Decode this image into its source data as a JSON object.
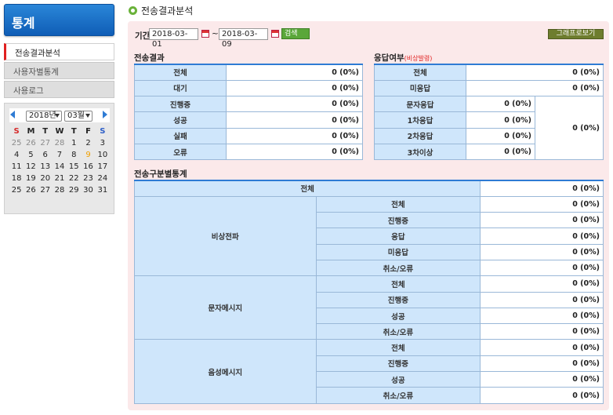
{
  "sidebar": {
    "title": "통계",
    "menu": [
      {
        "label": "전송결과분석",
        "active": true
      },
      {
        "label": "사용자별통계",
        "active": false
      },
      {
        "label": "사용로그",
        "active": false
      }
    ],
    "calendar": {
      "year_label": "2018년",
      "month_label": "03월",
      "weekdays": [
        "S",
        "M",
        "T",
        "W",
        "T",
        "F",
        "S"
      ],
      "weeks": [
        [
          "25",
          "26",
          "27",
          "28",
          "1",
          "2",
          "3"
        ],
        [
          "4",
          "5",
          "6",
          "7",
          "8",
          "9",
          "10"
        ],
        [
          "11",
          "12",
          "13",
          "14",
          "15",
          "16",
          "17"
        ],
        [
          "18",
          "19",
          "20",
          "21",
          "22",
          "23",
          "24"
        ],
        [
          "25",
          "26",
          "27",
          "28",
          "29",
          "30",
          "31"
        ]
      ],
      "colors": {
        "sunday": "#d62a2a",
        "saturday": "#2e5fc8",
        "other_month": "#8a8a8a",
        "today": "#f0a000",
        "normal": "#222222"
      }
    }
  },
  "page": {
    "title": "전송결과분석"
  },
  "filter": {
    "label": "기간",
    "start": "2018-03-01",
    "sep": "~",
    "end": "2018-03-09",
    "search_label": "검색",
    "graph_label": "그래프로보기"
  },
  "result": {
    "title": "전송결과",
    "rows": [
      {
        "label": "전체",
        "value": "0 (0%)"
      },
      {
        "label": "대기",
        "value": "0 (0%)"
      },
      {
        "label": "진행중",
        "value": "0 (0%)"
      },
      {
        "label": "성공",
        "value": "0 (0%)"
      },
      {
        "label": "실패",
        "value": "0 (0%)"
      },
      {
        "label": "오류",
        "value": "0 (0%)"
      }
    ]
  },
  "response": {
    "title": "응답여부",
    "title_note": "(비상발령)",
    "rows": [
      {
        "label": "전체",
        "value": "0 (0%)"
      },
      {
        "label": "미응답",
        "value": "0 (0%)"
      },
      {
        "label": "문자응답",
        "value": "0 (0%)"
      },
      {
        "label": "1차응답",
        "value": "0 (0%)"
      },
      {
        "label": "2차응답",
        "value": "0 (0%)"
      },
      {
        "label": "3차이상",
        "value": "0 (0%)"
      }
    ],
    "sum_value": "0 (0%)"
  },
  "category": {
    "title": "전송구분별통계",
    "total": {
      "label": "전체",
      "value": "0 (0%)"
    },
    "groups": [
      {
        "name": "비상전파",
        "rows": [
          {
            "label": "전체",
            "value": "0 (0%)"
          },
          {
            "label": "진행중",
            "value": "0 (0%)"
          },
          {
            "label": "응답",
            "value": "0 (0%)"
          },
          {
            "label": "미응답",
            "value": "0 (0%)"
          },
          {
            "label": "취소/오류",
            "value": "0 (0%)"
          }
        ]
      },
      {
        "name": "문자메시지",
        "rows": [
          {
            "label": "전체",
            "value": "0 (0%)"
          },
          {
            "label": "진행중",
            "value": "0 (0%)"
          },
          {
            "label": "성공",
            "value": "0 (0%)"
          },
          {
            "label": "취소/오류",
            "value": "0 (0%)"
          }
        ]
      },
      {
        "name": "음성메시지",
        "rows": [
          {
            "label": "전체",
            "value": "0 (0%)"
          },
          {
            "label": "진행중",
            "value": "0 (0%)"
          },
          {
            "label": "성공",
            "value": "0 (0%)"
          },
          {
            "label": "취소/오류",
            "value": "0 (0%)"
          }
        ]
      }
    ]
  }
}
